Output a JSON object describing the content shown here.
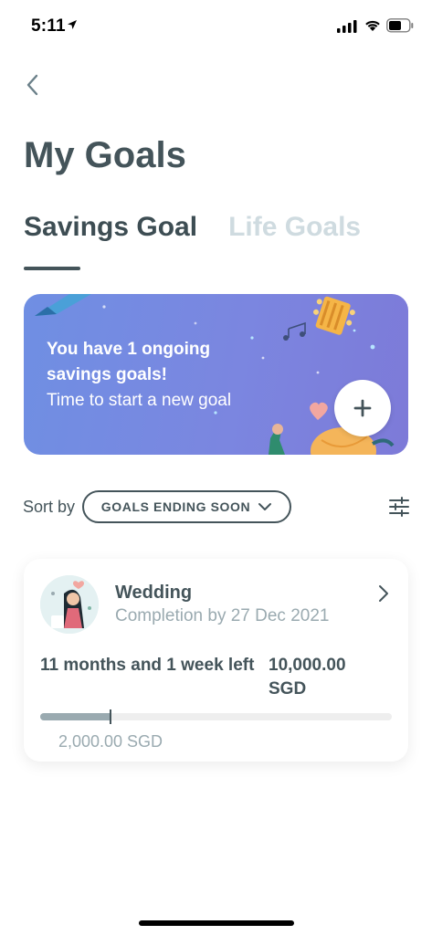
{
  "status_bar": {
    "time": "5:11"
  },
  "header": {
    "title": "My Goals"
  },
  "tabs": [
    {
      "label": "Savings Goal",
      "active": true
    },
    {
      "label": "Life Goals",
      "active": false
    }
  ],
  "banner": {
    "line1": "You have 1 ongoing",
    "line2": "savings goals!",
    "line3": "Time to start a new goal",
    "add_button_icon": "plus-icon"
  },
  "sort": {
    "label": "Sort by",
    "selected": "GOALS ENDING SOON"
  },
  "goals": [
    {
      "name": "Wedding",
      "completion": "Completion by 27 Dec 2021",
      "time_left": "11 months and 1 week left",
      "target": "10,000.00 SGD",
      "saved": "2,000.00 SGD",
      "progress_fraction": 0.2
    }
  ],
  "colors": {
    "primary_text": "#44545a",
    "muted_text": "#9aaab0",
    "inactive_tab": "#cfdbe0",
    "banner_start": "#6f8fe3",
    "banner_end": "#7d7ad8"
  }
}
